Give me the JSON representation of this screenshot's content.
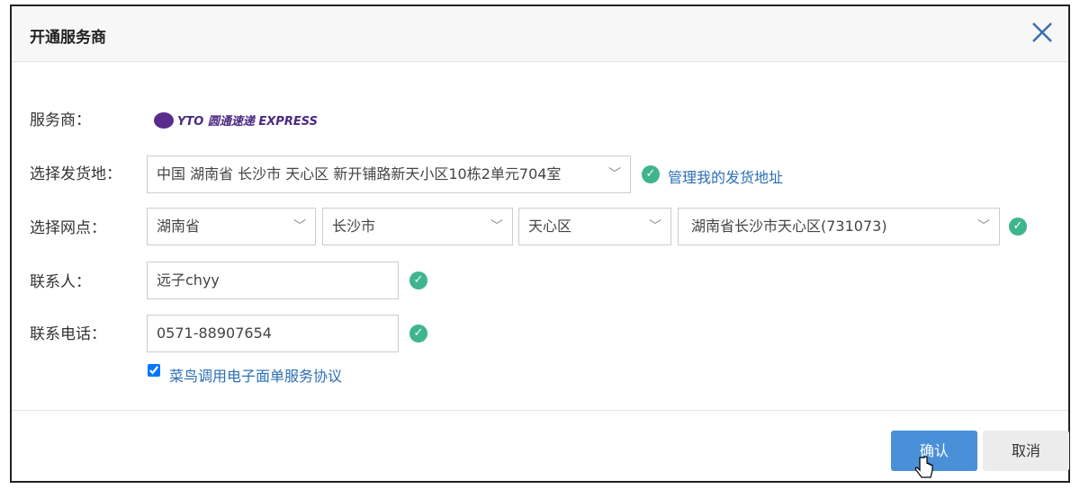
{
  "dialog": {
    "title": "开通服务商"
  },
  "form": {
    "provider_label": "服务商：",
    "provider_logo_text": "YTO 圆通速递 EXPRESS",
    "origin_label": "选择发货地：",
    "origin_value": "中国 湖南省 长沙市 天心区 新开铺路新天小区10栋2单元704室",
    "manage_link": "管理我的发货地址",
    "branch_label": "选择网点：",
    "province": "湖南省",
    "city": "长沙市",
    "district": "天心区",
    "branch": "湖南省长沙市天心区(731073)",
    "contact_label": "联系人：",
    "contact_value": "远子chyy",
    "phone_label": "联系电话：",
    "phone_value": "0571-88907654",
    "agreement_checked": true,
    "agreement_link": "菜鸟调用电子面单服务协议"
  },
  "footer": {
    "confirm": "确认",
    "cancel": "取消"
  },
  "colors": {
    "accent": "#4a90d9",
    "success": "#3fb58c"
  }
}
